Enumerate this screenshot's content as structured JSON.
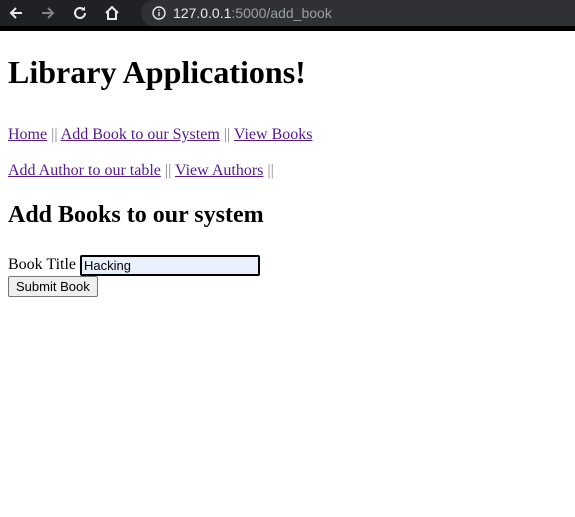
{
  "browser": {
    "url_host": "127.0.0.1",
    "url_rest": ":5000/add_book"
  },
  "page": {
    "title": "Library Applications!",
    "nav_line1": [
      {
        "label": "Home"
      },
      {
        "label": "Add Book to our System"
      },
      {
        "label": "View Books"
      }
    ],
    "nav_line2": [
      {
        "label": "Add Author to our table"
      },
      {
        "label": "View Authors"
      }
    ],
    "separator": "||",
    "subtitle": "Add Books to our system",
    "form": {
      "title_label": "Book Title",
      "title_value": "Hacking",
      "submit_label": "Submit Book"
    }
  }
}
